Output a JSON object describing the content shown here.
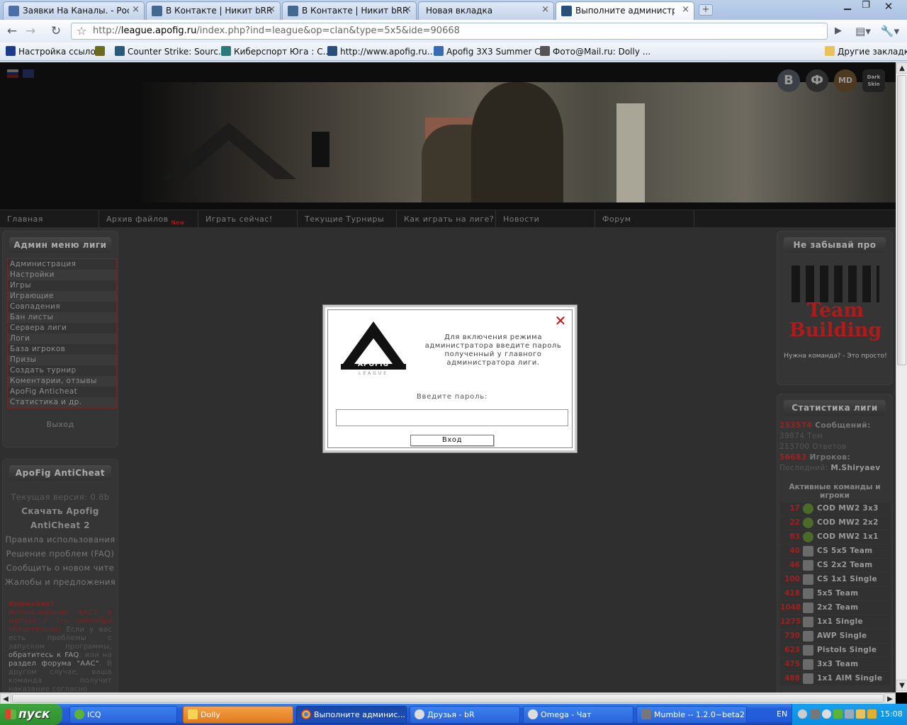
{
  "browser": {
    "tabs": [
      {
        "title": "Заявки На Каналы. - Росс...",
        "icon": "vk-league-icon",
        "active": false
      },
      {
        "title": "В Контакте | Никит bRRR...",
        "icon": "vk-icon",
        "active": false
      },
      {
        "title": "В Контакте | Никит bRRR...",
        "icon": "vk-icon",
        "active": false
      },
      {
        "title": "Новая вкладка",
        "icon": "",
        "active": false
      },
      {
        "title": "Выполните администрати...",
        "icon": "apofig-icon",
        "active": true
      }
    ],
    "new_tab": "+",
    "url_prefix": "http://",
    "url_domain": "league.apofig.ru",
    "url_path": "/index.php?ind=league&op=clan&type=5x5&ide=90668",
    "bookmarks": [
      {
        "label": "Настройка ссылок",
        "icon": "settings-icon"
      },
      {
        "label": "",
        "icon": "bug-icon"
      },
      {
        "label": "Counter Strike: Sourc...",
        "icon": "cs-icon"
      },
      {
        "label": "Киберспорт Юга : С...",
        "icon": "site-icon"
      },
      {
        "label": "http://www.apofig.ru...",
        "icon": "apofig-icon"
      },
      {
        "label": "Apofig 3X3 Summer C...",
        "icon": "apofig-icon"
      },
      {
        "label": "Фото@Mail.ru: Dolly ...",
        "icon": "camera-icon"
      }
    ],
    "other_bookmarks": "Другие закладки"
  },
  "site": {
    "social": [
      "B",
      "Ф",
      "MD",
      "Dark Skin"
    ],
    "menu": [
      {
        "label": "Главная"
      },
      {
        "label": "Архив файлов",
        "badge": "New"
      },
      {
        "label": "Играть сейчас!"
      },
      {
        "label": "Текущие Турниры"
      },
      {
        "label": "Как играть на лиге?"
      },
      {
        "label": "Новости"
      },
      {
        "label": "Форум"
      }
    ]
  },
  "admin_menu": {
    "title": "Админ меню лиги",
    "items": [
      "Администрация",
      "Настройки",
      "Игры",
      "Играющие",
      "Совпадения",
      "Бан листы",
      "Сервера лиги",
      "Логи",
      "База игроков",
      "Призы",
      "Создать турнир",
      "Коментарии, отзывы",
      "ApoFig Anticheat",
      "Статистика и др."
    ],
    "exit": "Выход"
  },
  "anticheat": {
    "title": "ApoFig AntiCheat",
    "version": "Текущая версия: 0.8b",
    "download_line1": "Скачать Apofig",
    "download_line2": "AntiCheat 2",
    "links": [
      "Правила использования",
      "Решение проблем (FAQ)",
      "Сообщить о новом чите",
      "Жалобы и предложения"
    ],
    "warning_title": "Внимание!",
    "warning_red": "Использование AAC2 в матчах с 1го сентября обязательно!",
    "warning_grey1": " Если у вас есть проблемы с запуском программы, ",
    "warning_faq": "обратитесь к FAQ",
    "warning_grey2": ", или на ",
    "warning_forum": "раздел форума \"AAC\"",
    "warning_grey3": ". В другом случае, ваша команда получит наказание согласно"
  },
  "reminder": {
    "title": "Не забывай про",
    "banner_title": "Team Building",
    "banner_sub": "Нужна команда? - Это просто!"
  },
  "stats": {
    "title": "Статистика лиги",
    "messages_count": "253574",
    "messages_label": " Сообщений:",
    "topics": "39874 Тем",
    "replies": "213700 Ответов",
    "players_count": "56683",
    "players_label": " Игроков:",
    "last_label": "Последний: ",
    "last_player": "M.Shiryaev",
    "active_title": "Активные команды и игроки",
    "teams": [
      {
        "count": "17",
        "name": "COD MW2 3x3",
        "game": "cod"
      },
      {
        "count": "22",
        "name": "COD MW2 2x2",
        "game": "cod"
      },
      {
        "count": "83",
        "name": "COD MW2 1x1",
        "game": "cod"
      },
      {
        "count": "40",
        "name": "CS 5x5 Team",
        "game": "cs"
      },
      {
        "count": "46",
        "name": "CS 2x2 Team",
        "game": "cs"
      },
      {
        "count": "100",
        "name": "CS 1x1 Single",
        "game": "cs"
      },
      {
        "count": "418",
        "name": "5x5 Team",
        "game": "cs"
      },
      {
        "count": "1048",
        "name": "2x2 Team",
        "game": "cs"
      },
      {
        "count": "1275",
        "name": "1x1 Single",
        "game": "cs"
      },
      {
        "count": "730",
        "name": "AWP Single",
        "game": "cs"
      },
      {
        "count": "623",
        "name": "Pistols Single",
        "game": "cs"
      },
      {
        "count": "475",
        "name": "3x3 Team",
        "game": "cs"
      },
      {
        "count": "488",
        "name": "1x1 AIM Single",
        "game": "cs"
      }
    ]
  },
  "modal": {
    "logo_text": "APOFIG",
    "logo_sub": "LEAGUE",
    "message": "Для включения режима администратора введите пароль полученный у главного администратора лиги.",
    "password_label": "Введите пароль:",
    "password_value": "",
    "login_button": "Вход",
    "close_glyph": "✕"
  },
  "taskbar": {
    "start": "пуск",
    "items": [
      {
        "label": "ICQ"
      },
      {
        "label": "Dolly"
      },
      {
        "label": "Выполните админис..."
      },
      {
        "label": "Друзья - bR"
      },
      {
        "label": "Omega - Чат"
      },
      {
        "label": "Mumble -- 1.2.0~beta2"
      }
    ],
    "lang": "EN",
    "clock": "15:08"
  },
  "colors": {
    "accent_red": "#9b2222",
    "link_red": "#c41010",
    "xp_blue": "#245edb",
    "xp_green": "#3ea53e"
  }
}
